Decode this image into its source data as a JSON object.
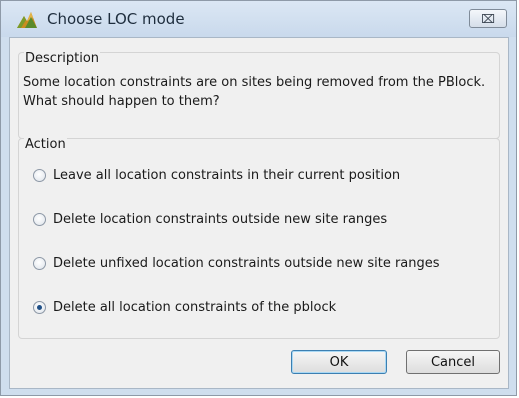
{
  "window": {
    "title": "Choose LOC mode",
    "close_label": "⌧"
  },
  "description": {
    "label": "Description",
    "text": "Some location constraints are on sites being removed from the PBlock. What should happen to them?"
  },
  "action": {
    "label": "Action",
    "options": [
      {
        "label": "Leave all location constraints in their current position",
        "selected": false
      },
      {
        "label": "Delete location constraints outside new site ranges",
        "selected": false
      },
      {
        "label": "Delete unfixed location constraints outside new site ranges",
        "selected": false
      },
      {
        "label": "Delete all location constraints of the pblock",
        "selected": true
      }
    ]
  },
  "buttons": {
    "ok": "OK",
    "cancel": "Cancel"
  },
  "colors": {
    "frame": "#cfdeee",
    "client": "#f0f0f0",
    "accent": "#3c7fb1"
  }
}
